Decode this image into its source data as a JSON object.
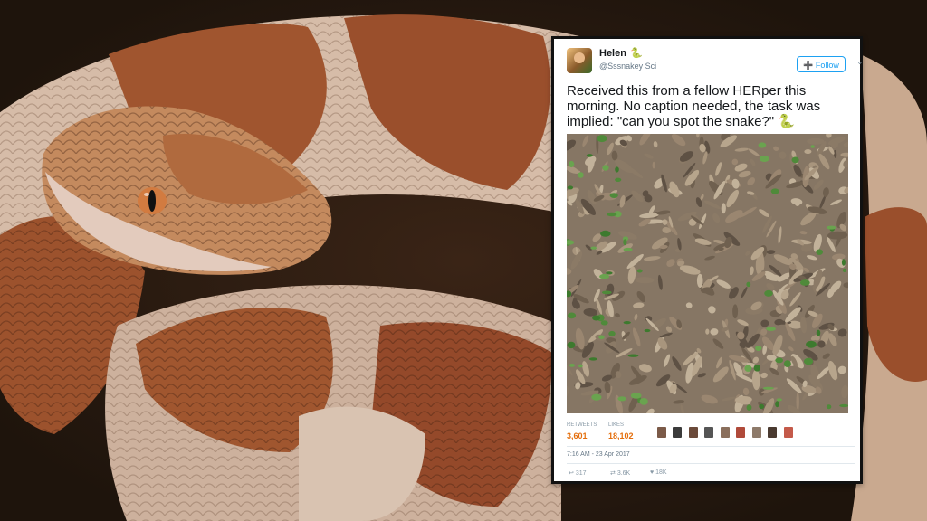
{
  "tweet": {
    "display_name": "Helen",
    "handle": "@Sssnakey Sci",
    "follow_label": "Follow",
    "text": "Received this from a fellow HERper this morning. No caption needed, the task was implied: \"can you spot the snake?\"",
    "retweets_label": "RETWEETS",
    "retweets": "3,601",
    "likes_label": "LIKES",
    "likes": "18,102",
    "timestamp": "7:16 AM - 23 Apr 2017",
    "actions": {
      "reply": "317",
      "retweet": "3.6K",
      "like": "18K"
    }
  },
  "colors": {
    "accent": "#1da1f2",
    "count": "#e46e0c",
    "snake_band_dark": "#8b4a2b",
    "snake_band_light": "#d9c2b0"
  },
  "icons": [
    "reply-icon",
    "retweet-icon",
    "heart-icon",
    "person-add-icon",
    "chevron-down-icon",
    "snake-emoji-icon"
  ]
}
